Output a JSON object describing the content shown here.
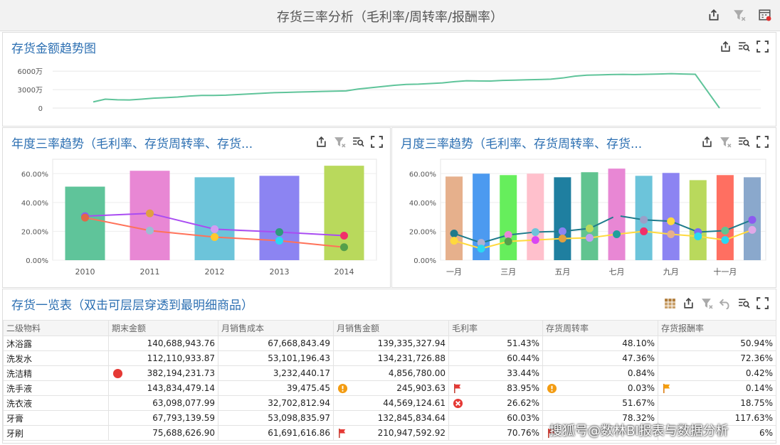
{
  "app_title": "存货三率分析（毛利率/周转率/报酬率）",
  "colors": {
    "title": "#2c6fb2",
    "trend_line": "#5fc49a",
    "gross": "#1f7b8c",
    "turnover": "#ffd93d",
    "ret": "#ff6f61"
  },
  "panels": {
    "trend": {
      "title": "存货金额趋势图"
    },
    "yearly": {
      "title": "年度三率趋势（毛利率、存货周转率、存货..."
    },
    "monthly": {
      "title": "月度三率趋势（毛利率、存货周转率、存货..."
    },
    "table": {
      "title": "存货一览表（双击可层层穿透到最明细商品）"
    }
  },
  "chart_data": [
    {
      "type": "line",
      "ylabels": [
        "6000万",
        "3000万",
        "0"
      ],
      "ylim": [
        0,
        6600
      ],
      "values": [
        1000,
        1450,
        1350,
        1320,
        1450,
        1600,
        1700,
        1800,
        1950,
        2050,
        2050,
        2100,
        2200,
        2300,
        2400,
        2500,
        2550,
        2600,
        2650,
        2700,
        2750,
        2800,
        3100,
        3300,
        3500,
        3700,
        3850,
        3900,
        4000,
        4100,
        4300,
        4450,
        4420,
        4400,
        4500,
        4550,
        4600,
        4650,
        4700,
        4900,
        5200,
        5350,
        5400,
        5450,
        5480,
        5450,
        5500,
        5550,
        5600,
        5550,
        5500,
        0
      ]
    },
    {
      "type": "bar",
      "categories": [
        "2010",
        "2011",
        "2012",
        "2013",
        "2014"
      ],
      "ylabels": [
        "60.00%",
        "40.00%",
        "20.00%",
        "0.00%"
      ],
      "ylim": [
        0,
        70
      ],
      "values": [
        51,
        62,
        57.5,
        58.5,
        65.5
      ],
      "bar_colors": [
        "#5fc49a",
        "#e887d4",
        "#6cc4da",
        "#8c84f2",
        "#b9d95c"
      ],
      "lines": [
        {
          "color": "#a94cf2",
          "values": [
            30.5,
            32.5,
            21.5,
            19.5,
            17
          ]
        },
        {
          "color": "#ff7259",
          "values": [
            29.5,
            20.5,
            16,
            13.5,
            9
          ]
        }
      ],
      "point_colors": [
        [
          "#8c5af0",
          "#e0a040",
          "#d29cf2",
          "#2e9b7c",
          "#f0306a"
        ],
        [
          "#e06848",
          "#9cbcd4",
          "#ffc82e",
          "#2ad8f2",
          "#54a04a"
        ]
      ]
    },
    {
      "type": "bar",
      "categories": [
        "一月",
        "",
        "三月",
        "",
        "五月",
        "",
        "七月",
        "",
        "九月",
        "",
        "十一月",
        ""
      ],
      "ylabels": [
        "60.00%",
        "40.00%",
        "20.00%",
        "0.00%"
      ],
      "ylim": [
        0,
        70
      ],
      "values": [
        58,
        60,
        59,
        60,
        57.5,
        61,
        63.5,
        58.5,
        60.5,
        55.5,
        59,
        57.5
      ],
      "bar_colors": [
        "#e6b08c",
        "#4c9af0",
        "#66ee5c",
        "#ffc0cc",
        "#1f7fa0",
        "#61c490",
        "#e887d4",
        "#6cc4da",
        "#8c84f2",
        "#b9d95c",
        "#ff6f61",
        "#8aa8cc"
      ],
      "lines": [
        {
          "color": "#1f7b8c",
          "values": [
            18.5,
            12,
            17.5,
            19.5,
            20,
            22,
            31,
            28,
            27,
            19.5,
            20.5,
            28
          ]
        },
        {
          "color": "#ffd93d",
          "values": [
            13.5,
            8,
            13,
            14,
            15,
            15.5,
            18,
            20,
            18,
            16.5,
            14,
            21
          ]
        }
      ],
      "point_colors": [
        [
          "#1f7b8c",
          "#b0b0d0",
          "#e887d4",
          "#6cc4da",
          "#8c84f2",
          "#b9d95c",
          "#e887d4",
          "#999fc8",
          "#ffd93d",
          "#7b6cf2",
          "#61c490",
          "#8c5af0"
        ],
        [
          "#ffd93d",
          "#2ad8f2",
          "#54a04a",
          "#d946f2",
          "#e0a040",
          "#c0a0f2",
          "#1f9f9c",
          "#f0306a",
          "#e6b08c",
          "#2ad8f2",
          "#2ad8f2",
          "#e0a8e8"
        ]
      ]
    }
  ],
  "table": {
    "columns": [
      "二级物料",
      "期末金额",
      "月销售成本",
      "月销售金额",
      "毛利率",
      "存货周转率",
      "存货报酬率"
    ],
    "rows": [
      [
        "沐浴露",
        "140,688,943.76",
        "67,668,843.49",
        "139,335,327.94",
        "51.43%",
        "48.10%",
        "50.94%"
      ],
      [
        "洗发水",
        "112,110,933.87",
        "53,101,196.43",
        "134,231,726.88",
        "60.44%",
        "47.36%",
        "72.36%"
      ],
      [
        "洗洁精",
        "382,194,231.73",
        "3,232,440.17",
        "4,856,780.00",
        "33.44%",
        "0.84%",
        "0.42%"
      ],
      [
        "洗手液",
        "143,834,479.14",
        "39,475.45",
        "245,903.63",
        "83.95%",
        "0.03%",
        "0.14%"
      ],
      [
        "洗衣液",
        "63,098,077.99",
        "32,702,812.94",
        "44,569,124.61",
        "26.62%",
        "51.67%",
        "18.75%"
      ],
      [
        "牙膏",
        "67,793,139.59",
        "53,098,835.97",
        "132,845,834.64",
        "60.03%",
        "78.32%",
        "117.63%"
      ],
      [
        "牙刷",
        "75,688,626.90",
        "61,691,616.86",
        "210,947,592.92",
        "70.76%",
        "",
        "6%"
      ]
    ],
    "markers": [
      {
        "row": 2,
        "col": 1,
        "icon": "red-dot-icon"
      },
      {
        "row": 3,
        "col": 3,
        "icon": "warning-icon"
      },
      {
        "row": 3,
        "col": 4,
        "icon": "red-flag-icon"
      },
      {
        "row": 3,
        "col": 5,
        "icon": "warning-icon"
      },
      {
        "row": 3,
        "col": 6,
        "icon": "orange-flag-icon"
      },
      {
        "row": 4,
        "col": 4,
        "icon": "error-icon"
      },
      {
        "row": 6,
        "col": 3,
        "icon": "red-flag-icon"
      },
      {
        "row": 6,
        "col": 5,
        "icon": "red-flag-icon"
      }
    ]
  },
  "watermark": "搜狐号@数林BI报表与数据分析"
}
